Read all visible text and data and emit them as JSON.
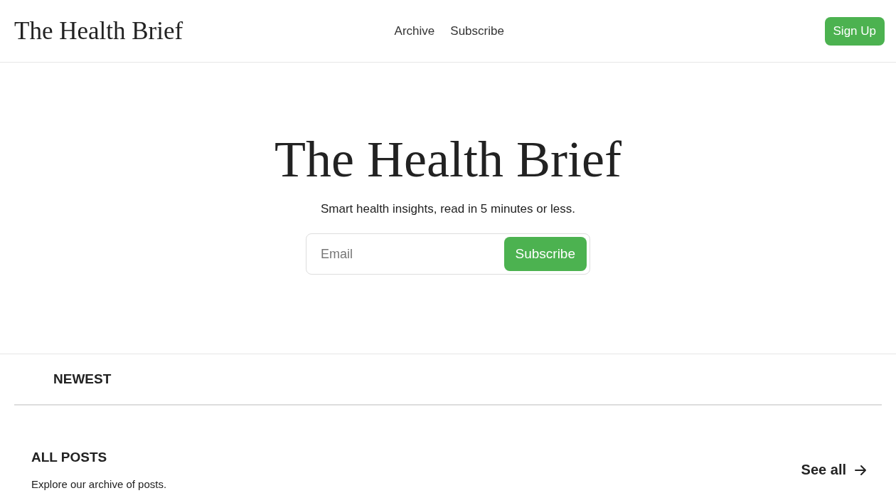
{
  "header": {
    "logo": "The Health Brief",
    "nav": [
      "Archive",
      "Subscribe"
    ],
    "signup_button": "Sign Up"
  },
  "hero": {
    "title": "The Health Brief",
    "tagline": "Smart health insights, read in 5 minutes or less.",
    "email": {
      "placeholder": "Email"
    },
    "subscribe_button": "Subscribe"
  },
  "tabs": [
    {
      "label": "NEWEST"
    }
  ],
  "all_posts": {
    "heading": "ALL POSTS",
    "description": "Explore our archive of posts.",
    "see_all": "See all"
  }
}
